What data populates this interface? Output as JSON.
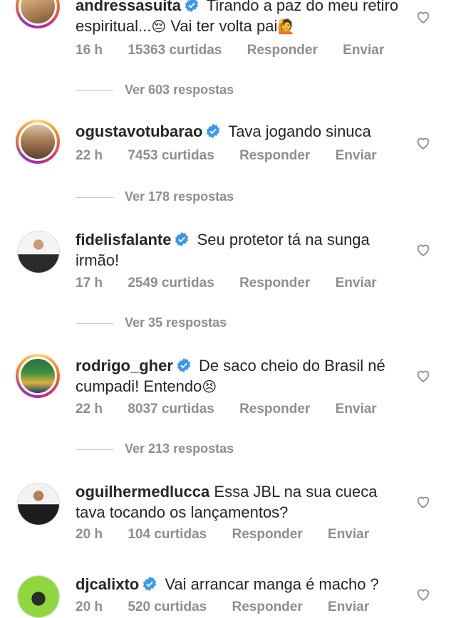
{
  "comments": [
    {
      "username": "andressasuita",
      "text": "Tirando a paz do meu retiro espiritual...",
      "emoji": "😔",
      "text2": "Vai ter volta pai",
      "emoji2": "🙋",
      "time": "16 h",
      "likes": "15363 curtidas",
      "reply": "Responder",
      "send": "Enviar",
      "replies": "Ver 603 respostas"
    },
    {
      "username": "ogustavotubarao",
      "text": "Tava jogando sinuca",
      "time": "22 h",
      "likes": "7453 curtidas",
      "reply": "Responder",
      "send": "Enviar",
      "replies": "Ver 178 respostas"
    },
    {
      "username": "fidelisfalante",
      "text": "Seu protetor tá na sunga irmão!",
      "time": "17 h",
      "likes": "2549 curtidas",
      "reply": "Responder",
      "send": "Enviar",
      "replies": "Ver 35 respostas"
    },
    {
      "username": "rodrigo_gher",
      "text": "De saco cheio do Brasil né cumpadi! Entendo",
      "emoji": "😣",
      "time": "22 h",
      "likes": "8037 curtidas",
      "reply": "Responder",
      "send": "Enviar",
      "replies": "Ver 213 respostas"
    },
    {
      "username": "oguilhermedlucca",
      "text": "Essa JBL na sua cueca tava tocando os lançamentos?",
      "time": "20 h",
      "likes": "104 curtidas",
      "reply": "Responder",
      "send": "Enviar"
    },
    {
      "username": "djcalixto",
      "text": "Vai arrancar manga é macho ?",
      "time": "20 h",
      "likes": "520 curtidas",
      "reply": "Responder",
      "send": "Enviar"
    }
  ],
  "colors": {
    "verified": "#3897f0",
    "muted": "#8e8e8e",
    "text": "#262626"
  }
}
